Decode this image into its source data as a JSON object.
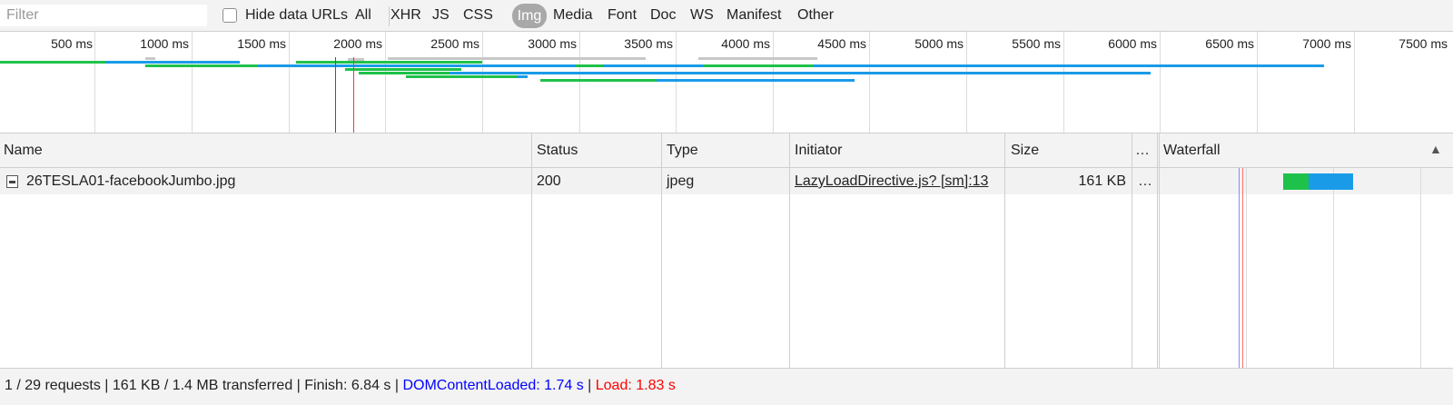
{
  "filter": {
    "placeholder": "Filter",
    "value": ""
  },
  "hide_data_urls": {
    "label": "Hide data URLs",
    "checked": false
  },
  "type_filters": [
    "All",
    "XHR",
    "JS",
    "CSS",
    "Img",
    "Media",
    "Font",
    "Doc",
    "WS",
    "Manifest",
    "Other"
  ],
  "active_type_filter": "Img",
  "overview": {
    "tick_labels": [
      "500 ms",
      "1000 ms",
      "1500 ms",
      "2000 ms",
      "2500 ms",
      "3000 ms",
      "3500 ms",
      "4000 ms",
      "4500 ms",
      "5000 ms",
      "5500 ms",
      "6000 ms",
      "6500 ms",
      "7000 ms",
      "7500 ms"
    ],
    "dom_content_loaded_ms": 1740,
    "load_ms": 1830,
    "colors": {
      "waiting": "#1ec24a",
      "download": "#1a9be8",
      "queued": "#c8c8c8",
      "dcl": "#4040ff",
      "load": "#ff3333"
    }
  },
  "columns": {
    "name": "Name",
    "status": "Status",
    "type": "Type",
    "initiator": "Initiator",
    "size": "Size",
    "more": "…",
    "waterfall": "Waterfall",
    "sort_indicator": "▲"
  },
  "rows": [
    {
      "icon": "image-file-icon",
      "name": "26TESLA01-facebookJumbo.jpg",
      "status": "200",
      "type": "jpeg",
      "initiator": "LazyLoadDirective.js? [sm]:13",
      "size": "161 KB",
      "more": "…"
    }
  ],
  "status_bar": {
    "summary": "1 / 29 requests | 161 KB / 1.4 MB transferred | Finish: 6.84 s | ",
    "dcl_text": "DOMContentLoaded: 1.74 s",
    "separator": " | ",
    "load_text": "Load: 1.83 s",
    "dcl_color": "#0000ff",
    "load_color": "#ff0000"
  }
}
